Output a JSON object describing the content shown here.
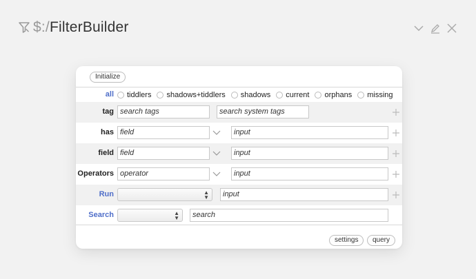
{
  "title": {
    "prefix": "$:/",
    "name": "FilterBuilder"
  },
  "icons": {
    "title": "filter-icon",
    "collapse": "chevron-down-icon",
    "edit": "pencil-icon",
    "close": "close-icon"
  },
  "buttons": {
    "initialize": "Initialize",
    "settings": "settings",
    "query": "query"
  },
  "all_row": {
    "label": "all",
    "options": [
      "tiddlers",
      "shadows+tiddlers",
      "shadows",
      "current",
      "orphans",
      "missing"
    ]
  },
  "tag_row": {
    "label": "tag",
    "placeholder1": "search tags",
    "placeholder2": "search system tags"
  },
  "has_row": {
    "label": "has",
    "placeholder1": "field",
    "placeholder2": "input"
  },
  "field_row": {
    "label": "field",
    "placeholder1": "field",
    "placeholder2": "input"
  },
  "operators_row": {
    "label": "Operators",
    "placeholder1": "operator",
    "placeholder2": "input"
  },
  "run_row": {
    "label": "Run",
    "select_value": "",
    "placeholder": "input"
  },
  "search_row": {
    "label": "Search",
    "select_value": "",
    "placeholder": "search"
  },
  "colors": {
    "accent": "#4f6ec9",
    "row_shade": "#f1f1f1",
    "background": "#f2f2f2"
  }
}
